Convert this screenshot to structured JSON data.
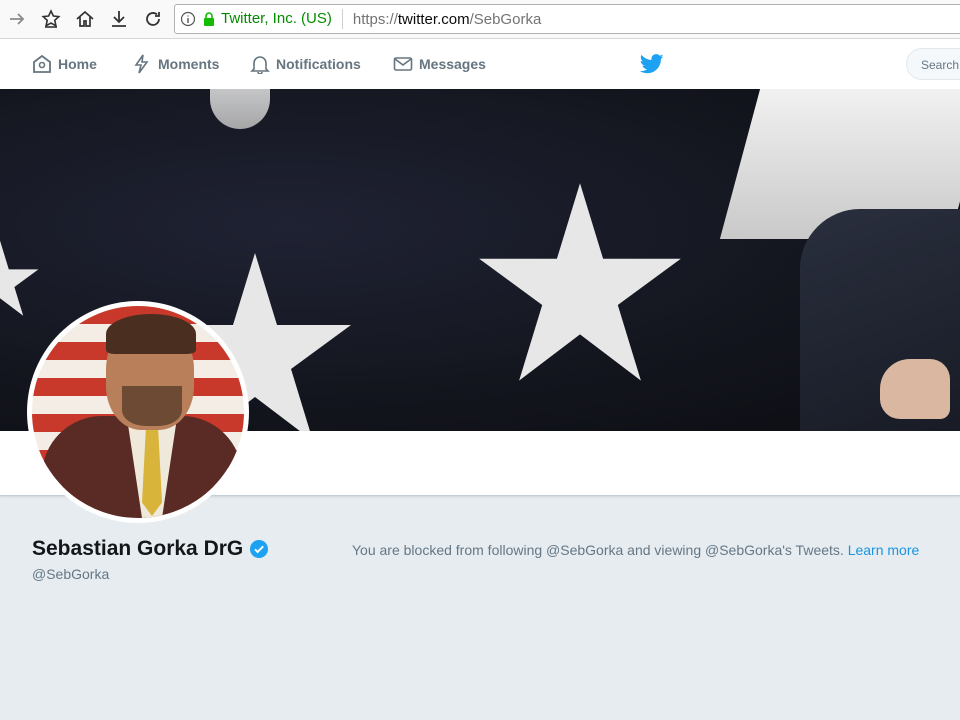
{
  "browser": {
    "identity": "Twitter, Inc. (US)",
    "url_prefix": "https://",
    "url_host": "twitter.com",
    "url_path": "/SebGorka"
  },
  "nav": {
    "home": "Home",
    "moments": "Moments",
    "notifications": "Notifications",
    "messages": "Messages",
    "search_placeholder": "Search"
  },
  "profile": {
    "name": "Sebastian Gorka DrG",
    "handle": "@SebGorka",
    "blocked_message": "You are blocked from following @SebGorka and viewing @SebGorka's Tweets.",
    "learn_more": "Learn more"
  },
  "colors": {
    "twitter_blue": "#1da1f2",
    "link_blue": "#1b95e0",
    "secure_green": "#058b00"
  }
}
